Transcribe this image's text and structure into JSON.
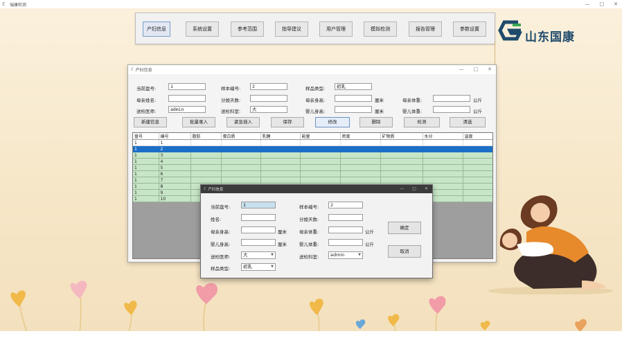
{
  "app": {
    "title": "瑞康检测",
    "win_controls": [
      "—",
      "□",
      "✕"
    ]
  },
  "menu": [
    {
      "label": "产妇信息",
      "active": true
    },
    {
      "label": "系统设置",
      "active": false
    },
    {
      "label": "参考范围",
      "active": false
    },
    {
      "label": "指导建议",
      "active": false
    },
    {
      "label": "用户管理",
      "active": false
    },
    {
      "label": "模拟检测",
      "active": false
    },
    {
      "label": "报告管理",
      "active": false
    },
    {
      "label": "参数设置",
      "active": false
    }
  ],
  "logo": {
    "text": "山东国康"
  },
  "main_window": {
    "title": "产妇信息",
    "form": {
      "current_bed_label": "当前盘号:",
      "current_bed_value": "1",
      "sample_no_label": "样本编号:",
      "sample_no_value": "2",
      "sample_type_label": "样品类型:",
      "sample_type_value": "初乳",
      "mother_name_label": "母亲姓名:",
      "mother_name_value": "",
      "lactation_days_label": "分娩天数:",
      "lactation_days_value": "",
      "mother_height_label": "母亲身高:",
      "mother_height_value": "",
      "mother_height_unit": "厘米",
      "mother_weight_label": "母亲体重:",
      "mother_weight_value": "",
      "mother_weight_unit": "公斤",
      "doctor_label": "送检医师:",
      "doctor_value": "admin",
      "dept_label": "送检科室:",
      "dept_value": "大",
      "baby_height_label": "婴儿身高:",
      "baby_height_value": "",
      "baby_height_unit": "厘米",
      "baby_weight_label": "婴儿体重:",
      "baby_weight_value": "",
      "baby_weight_unit": "公斤"
    },
    "actions": [
      "新建信息",
      "批量录入",
      "紧急插入",
      "保存",
      "修改",
      "删除",
      "检测",
      "清选"
    ],
    "table": {
      "headers": [
        "盘号",
        "编号",
        "脂肪",
        "蛋白质",
        "乳糖",
        "能量",
        "密度",
        "矿物质",
        "水分",
        "温度"
      ],
      "rows": [
        [
          "1",
          "1",
          "",
          "",
          "",
          "",
          "",
          "",
          "",
          ""
        ],
        [
          "1",
          "2",
          "",
          "",
          "",
          "",
          "",
          "",
          "",
          ""
        ],
        [
          "1",
          "3",
          "",
          "",
          "",
          "",
          "",
          "",
          "",
          ""
        ],
        [
          "1",
          "4",
          "",
          "",
          "",
          "",
          "",
          "",
          "",
          ""
        ],
        [
          "1",
          "5",
          "",
          "",
          "",
          "",
          "",
          "",
          "",
          ""
        ],
        [
          "1",
          "6",
          "",
          "",
          "",
          "",
          "",
          "",
          "",
          ""
        ],
        [
          "1",
          "7",
          "",
          "",
          "",
          "",
          "",
          "",
          "",
          ""
        ],
        [
          "1",
          "8",
          "",
          "",
          "",
          "",
          "",
          "",
          "",
          ""
        ],
        [
          "1",
          "9",
          "",
          "",
          "",
          "",
          "",
          "",
          "",
          ""
        ],
        [
          "1",
          "10",
          "",
          "",
          "",
          "",
          "",
          "",
          "",
          ""
        ]
      ]
    }
  },
  "dialog": {
    "title": "产妇信息",
    "current_bed_label": "当前盘号:",
    "current_bed_value": "1",
    "sample_no_label": "样本编号:",
    "sample_no_value": "2",
    "name_label": "姓名:",
    "name_value": "",
    "lactation_days_label": "分娩天数:",
    "lactation_days_value": "",
    "mother_height_label": "母亲身高:",
    "mother_height_value": "",
    "mother_height_unit": "厘米",
    "mother_weight_label": "母亲体重:",
    "mother_weight_value": "",
    "mother_weight_unit": "公斤",
    "baby_height_label": "婴儿身高:",
    "baby_height_value": "",
    "baby_height_unit": "厘米",
    "baby_weight_label": "婴儿体重:",
    "baby_weight_value": "",
    "baby_weight_unit": "公斤",
    "doctor_label": "送检医师:",
    "doctor_value": "大",
    "dept_label": "送检科室:",
    "dept_value": "admin",
    "sample_type_label": "样品类型:",
    "sample_type_value": "初乳",
    "ok_label": "确定",
    "cancel_label": "取消"
  },
  "colors": {
    "accent": "#1c6fc7",
    "row_green": "#c7e6c7",
    "logo_blue": "#1f4a6b",
    "logo_green": "#3aa655"
  }
}
